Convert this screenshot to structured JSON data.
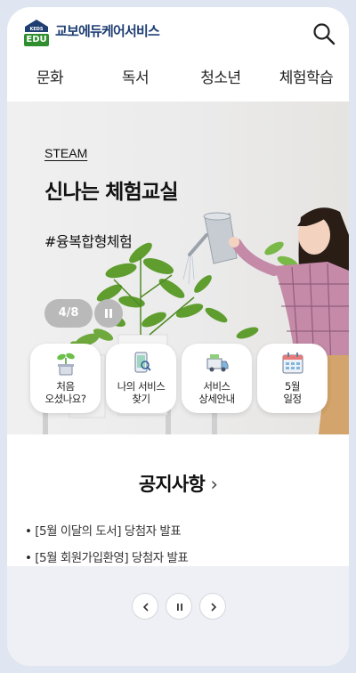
{
  "header": {
    "logo_badge": "KEDS",
    "logo_edu": "EDU",
    "logo_text": "교보에듀케어서비스",
    "search_icon": "search-icon"
  },
  "nav": {
    "items": [
      {
        "label": "문화"
      },
      {
        "label": "독서"
      },
      {
        "label": "청소년"
      },
      {
        "label": "체험학습"
      }
    ]
  },
  "hero": {
    "tag": "STEAM",
    "title": "신나는 체험교실",
    "hashtag": "#융복합형체험",
    "counter": "4/8",
    "pause_icon": "pause-icon"
  },
  "quick_menu": {
    "items": [
      {
        "label": "처음\n오셨나요?",
        "icon": "sprout-icon"
      },
      {
        "label": "나의 서비스\n찾기",
        "icon": "phone-search-icon"
      },
      {
        "label": "서비스\n상세안내",
        "icon": "truck-icon"
      },
      {
        "label": "5월\n일정",
        "icon": "calendar-icon"
      }
    ]
  },
  "notice": {
    "title": "공지사항",
    "arrow": "›",
    "items": [
      {
        "text": "[5월 이달의 도서] 당첨자 발표"
      },
      {
        "text": "[5월 회원가입환영] 당첨자 발표"
      }
    ]
  },
  "colors": {
    "brand_navy": "#1f3f73",
    "brand_green": "#2f8f2f",
    "counter_gray": "#b9b9b9"
  }
}
